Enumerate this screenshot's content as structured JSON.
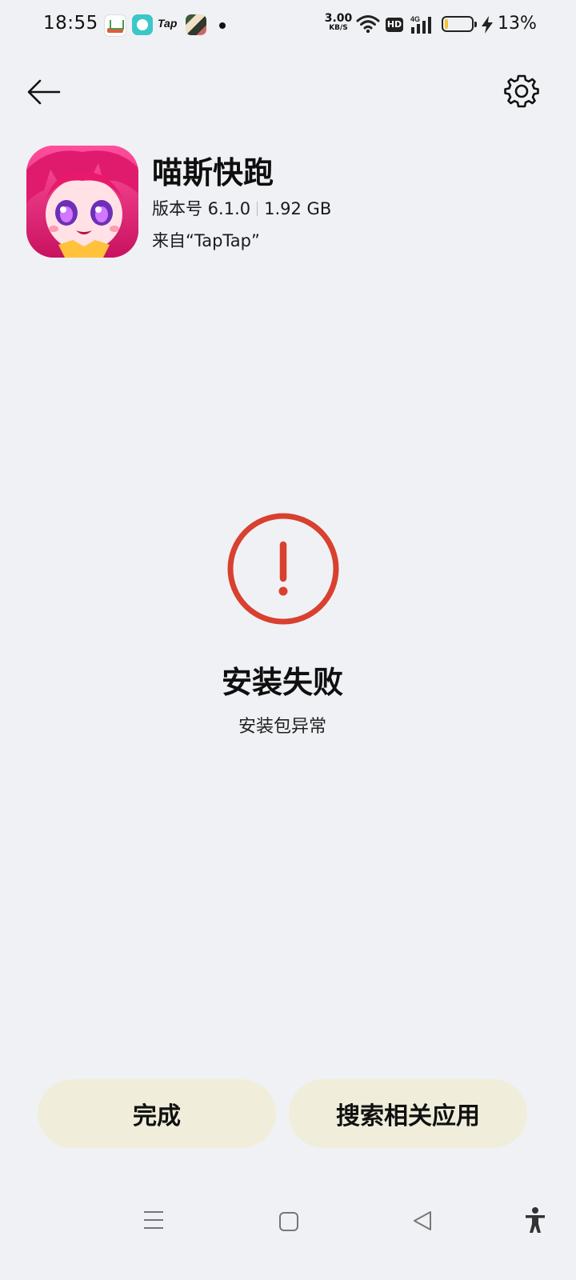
{
  "status_bar": {
    "time": "18:55",
    "tap_label": "Tap",
    "net_speed_value": "3.00",
    "net_speed_unit": "KB/S",
    "hd_label": "HD",
    "network_label": "4G",
    "battery_percent_text": "13%",
    "battery_level": 0.13,
    "battery_color": "#f3c33b"
  },
  "app": {
    "name": "喵斯快跑",
    "version": "版本号 6.1.0",
    "size": "1.92 GB",
    "source": "来自“TapTap”"
  },
  "result": {
    "title": "安装失败",
    "reason": "安装包异常",
    "error_color": "#d8402f"
  },
  "buttons": {
    "done_label": "完成",
    "search_label": "搜索相关应用",
    "button_bg": "#f0eedb"
  },
  "icons": {
    "back": "arrow-left-icon",
    "settings": "gear-icon",
    "error": "exclamation-circle-icon",
    "nav_menu": "menu-lines-icon",
    "nav_home": "square-home-icon",
    "nav_back": "triangle-back-icon",
    "accessibility": "accessibility-person-icon"
  }
}
